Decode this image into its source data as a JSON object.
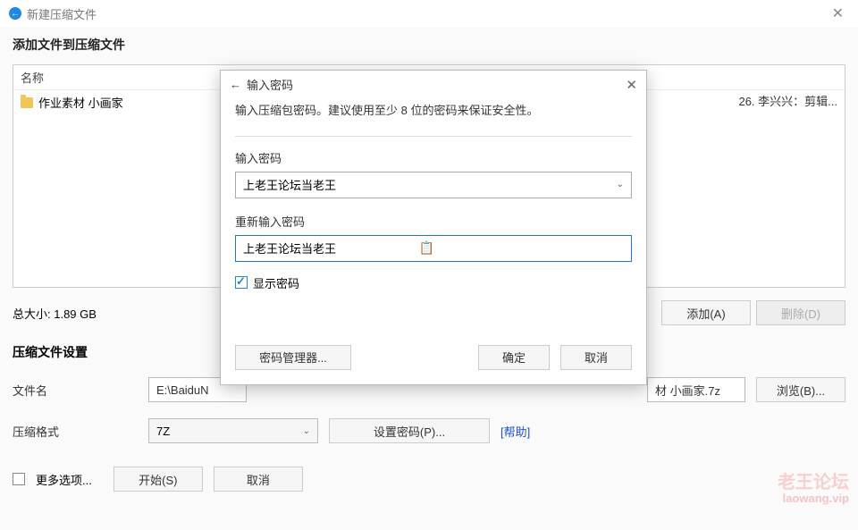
{
  "window": {
    "title": "新建压缩文件"
  },
  "addSection": {
    "title": "添加文件到压缩文件",
    "header_name": "名称",
    "file1": "作业素材 小画家",
    "right_truncated": "26. 李兴兴：剪辑...",
    "total_label": "总大小: 1.89 GB",
    "add_btn": "添加(A)",
    "delete_btn": "删除(D)"
  },
  "settings": {
    "title": "压缩文件设置",
    "filename_label": "文件名",
    "filename_value": "E:\\BaiduN",
    "filename_suffix": "材 小画家.7z",
    "browse_btn": "浏览(B)...",
    "format_label": "压缩格式",
    "format_value": "7Z",
    "set_password_btn": "设置密码(P)...",
    "help_link": "[帮助]"
  },
  "bottom": {
    "more_options": "更多选项...",
    "start_btn": "开始(S)",
    "cancel_btn": "取消"
  },
  "modal": {
    "title": "输入密码",
    "hint": "输入压缩包密码。建议使用至少 8 位的密码来保证安全性。",
    "pw_label": "输入密码",
    "pw_value": "上老王论坛当老王",
    "repw_label": "重新输入密码",
    "repw_value": "上老王论坛当老王",
    "show_pw": "显示密码",
    "manager_btn": "密码管理器...",
    "ok_btn": "确定",
    "cancel_btn": "取消"
  },
  "watermark": {
    "line1": "老王论坛",
    "line2": "laowang.vip"
  }
}
